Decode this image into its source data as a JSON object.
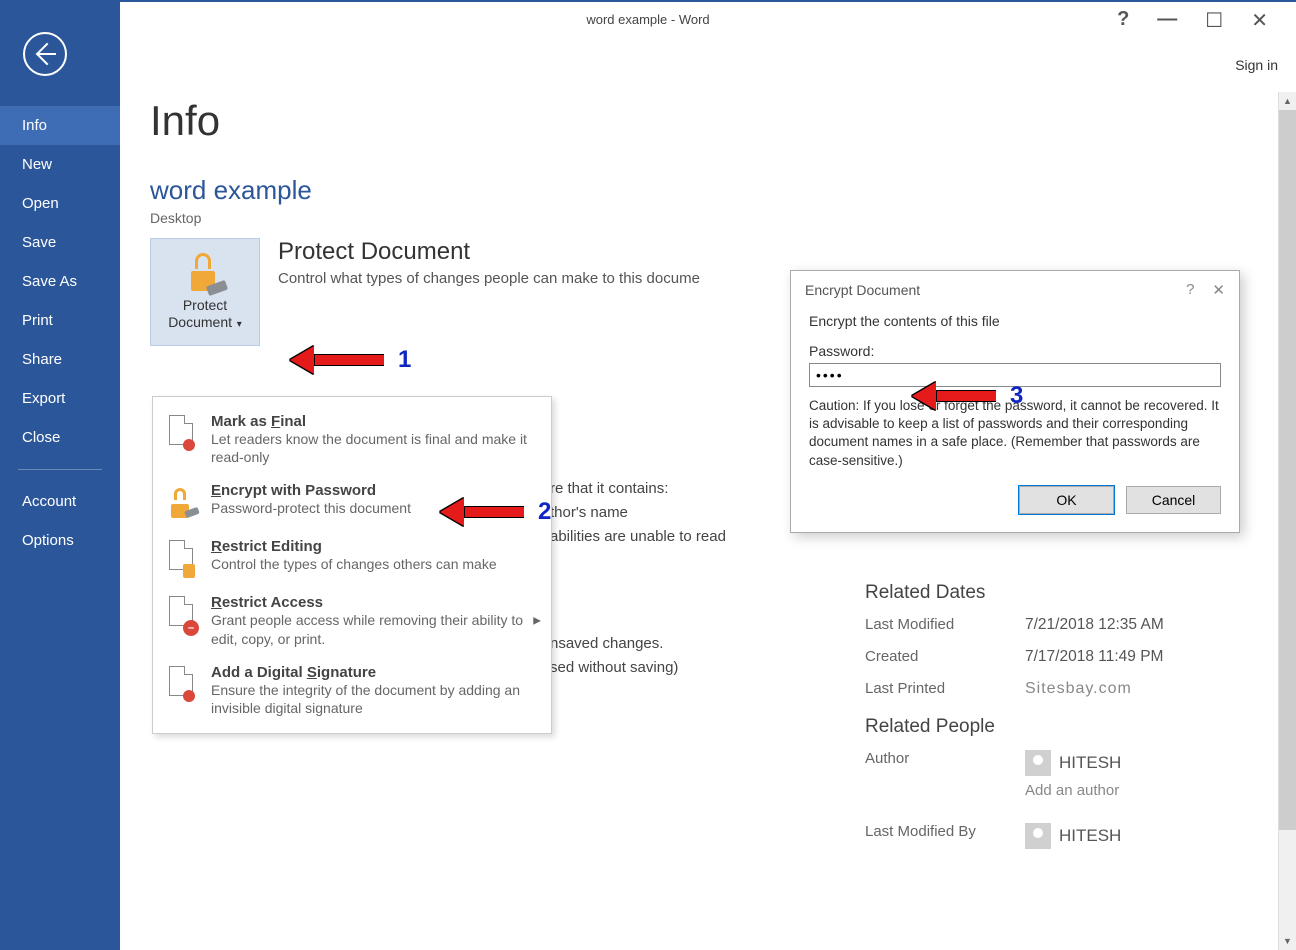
{
  "titlebar": {
    "title": "word example - Word",
    "signin": "Sign in"
  },
  "sidebar": {
    "items": [
      "Info",
      "New",
      "Open",
      "Save",
      "Save As",
      "Print",
      "Share",
      "Export",
      "Close"
    ],
    "bottom": [
      "Account",
      "Options"
    ]
  },
  "page": {
    "title": "Info",
    "docname": "word example",
    "doclocation": "Desktop"
  },
  "protect": {
    "btn_line1": "Protect",
    "btn_line2": "Document",
    "heading": "Protect Document",
    "desc": "Control what types of changes people can make to this docume"
  },
  "dropdown": {
    "mark_title": "Mark as Final",
    "mark_title_u": "F",
    "mark_desc": "Let readers know the document is final and make it read-only",
    "encrypt_title": "Encrypt with Password",
    "encrypt_title_u": "E",
    "encrypt_desc": "Password-protect this document",
    "restrict_edit_title": "Restrict Editing",
    "restrict_edit_title_u": "R",
    "restrict_edit_desc": "Control the types of changes others can make",
    "restrict_access_title": "Restrict Access",
    "restrict_access_title_u": "R",
    "restrict_access_desc": "Grant people access while removing their ability to edit, copy, or print.",
    "signature_title": "Add a Digital Signature",
    "signature_title_u": "S",
    "signature_desc": "Ensure the integrity of the document by adding an invisible digital signature"
  },
  "bgtext": {
    "l1": "re that it contains:",
    "l2": "thor's name",
    "l3": "abilities are unable to read",
    "l4": "nsaved changes.",
    "l5": "sed without saving)"
  },
  "dialog": {
    "title": "Encrypt Document",
    "instruction": "Encrypt the contents of this file",
    "label": "Password:",
    "value": "••••",
    "caution": "Caution: If you lose or forget the password, it cannot be recovered. It is advisable to keep a list of passwords and their corresponding document names in a safe place. (Remember that passwords are case-sensitive.)",
    "ok": "OK",
    "cancel": "Cancel"
  },
  "props": {
    "dates_heading": "Related Dates",
    "last_modified_k": "Last Modified",
    "last_modified_v": "7/21/2018 12:35 AM",
    "created_k": "Created",
    "created_v": "7/17/2018 11:49 PM",
    "last_printed_k": "Last Printed",
    "last_printed_v": "Sitesbay.com",
    "people_heading": "Related People",
    "author_k": "Author",
    "author_v": "HITESH",
    "add_author": "Add an author",
    "lastmod_k": "Last Modified By",
    "lastmod_v": "HITESH"
  },
  "anno": {
    "n1": "1",
    "n2": "2",
    "n3": "3"
  }
}
